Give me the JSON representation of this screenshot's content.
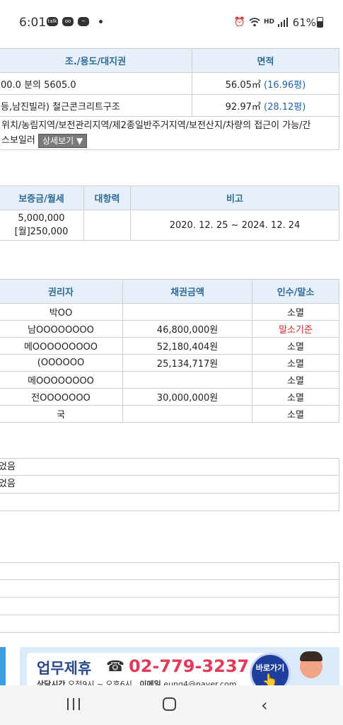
{
  "status_bar": {
    "time": "6:01",
    "left_icons": [
      "talk-icon",
      "voicemail-icon",
      "messenger-icon",
      "dot-icon"
    ],
    "right_icons": [
      "alarm-icon",
      "wifi-icon",
      "hd-voice-icon",
      "signal-icon"
    ],
    "battery": "61%"
  },
  "building_table": {
    "headers": [
      "조./용도/대지권",
      "면적"
    ],
    "rows": [
      {
        "left": "00.0 분의 5605.0",
        "area": "56.05㎡",
        "pyeong": "(16.96평)"
      },
      {
        "left": "등,남진빌라) 철근콘크리트구조",
        "area": "92.97㎡",
        "pyeong": "(28.12평)"
      }
    ],
    "note": " 위치/농림지역/보전관리지역/제2종일반주거지역/보전산지/차량의 접근이 가능/간\n스보일러",
    "detail_button": "상세보기 ▼"
  },
  "lease_table": {
    "headers": [
      "보증금/월세",
      "대항력",
      "비고"
    ],
    "row": {
      "deposit": "5,000,000",
      "rent": "[월]250,000",
      "opposing": "",
      "note": "2020. 12. 25 ~ 2024. 12. 24"
    }
  },
  "rights_table": {
    "headers": [
      "권리자",
      "채권금액",
      "인수/말소"
    ],
    "rows": [
      {
        "holder": "박OO",
        "amount": "",
        "status": "소멸"
      },
      {
        "holder": "남OOOOOOOO",
        "amount": "46,800,000원",
        "status": "말소기준"
      },
      {
        "holder": "메OOOOOOOOO",
        "amount": "52,180,404원",
        "status": "소멸"
      },
      {
        "holder": "(OOOOOO",
        "amount": "25,134,717원",
        "status": "소멸"
      },
      {
        "holder": "메OOOOOOOO",
        "amount": "",
        "status": "소멸"
      },
      {
        "holder": "전OOOOOOO",
        "amount": "30,000,000원",
        "status": "소멸"
      },
      {
        "holder": "국",
        "amount": "",
        "status": "소멸"
      }
    ]
  },
  "list_block_1": [
    "었음",
    "었음",
    ""
  ],
  "list_block_2": [
    "",
    "",
    "",
    ""
  ],
  "banner": {
    "title": "업무제휴",
    "phone_icon": "☎",
    "phone": "02-779-3237",
    "hours_label": "상담시간",
    "hours": "오전9시 ~ 오후6시",
    "email_label": "이메일",
    "email": "eung4@naver.com",
    "button": "바로가기"
  },
  "colors": {
    "header_bg": "#e7f0f8",
    "header_text": "#2f6a97",
    "link_blue": "#2163b3",
    "red": "#c8282a"
  }
}
